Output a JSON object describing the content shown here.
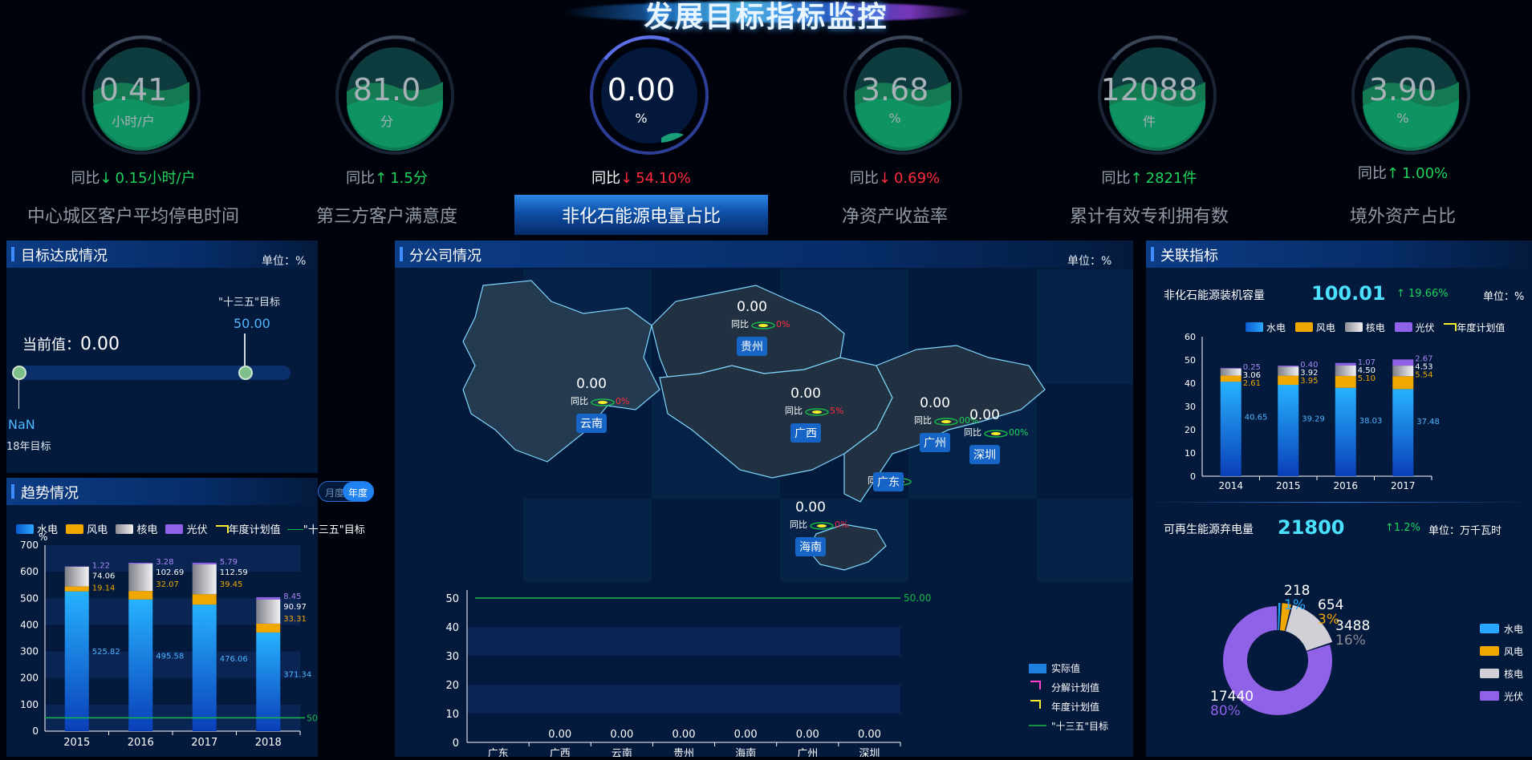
{
  "header": {
    "title": "发展目标指标监控"
  },
  "colors": {
    "hydro": "#1f7fe0",
    "wind": "#f0a800",
    "nuclear": "#c8c8cc",
    "solar": "#8f62e8",
    "up": "#1bd35d",
    "down": "#ff2a3d",
    "plan_line": "#f6f02c",
    "target_line": "#18b848"
  },
  "kpis": [
    {
      "value": "0.41",
      "unit": "小时/户",
      "compare_label": "同比",
      "arrow": "↓",
      "compare_value": "0.15小时/户",
      "trend": "up",
      "label": "中心城区客户平均停电时间"
    },
    {
      "value": "81.0",
      "unit": "分",
      "compare_label": "同比",
      "arrow": "↑",
      "compare_value": "1.5分",
      "trend": "up",
      "label": "第三方客户满意度"
    },
    {
      "value": "0.00",
      "unit": "%",
      "compare_label": "同比",
      "arrow": "↓",
      "compare_value": "54.10%",
      "trend": "down",
      "label": "非化石能源电量占比"
    },
    {
      "value": "3.68",
      "unit": "%",
      "compare_label": "同比",
      "arrow": "↓",
      "compare_value": "0.69%",
      "trend": "down",
      "label": "净资产收益率"
    },
    {
      "value": "12088",
      "unit": "件",
      "compare_label": "同比",
      "arrow": "↑",
      "compare_value": "2821件",
      "trend": "up",
      "label": "累计有效专利拥有数"
    },
    {
      "value": "3.90",
      "unit": "%",
      "compare_label": "同比",
      "arrow": "↑",
      "compare_value": "1.00%",
      "trend": "up",
      "label": "境外资产占比"
    }
  ],
  "target_panel": {
    "title": "目标达成情况",
    "unit": "单位：%",
    "current_label": "当前值：",
    "current_value": "0.00",
    "goal_label": "\"十三五\"目标",
    "goal_value": "50.00",
    "year_value": "NaN",
    "year_label": "18年目标"
  },
  "trend_panel": {
    "title": "趋势情况",
    "toggle": {
      "monthly": "月度",
      "yearly": "年度"
    },
    "legend": [
      "水电",
      "风电",
      "核电",
      "光伏",
      "年度计划值",
      "\"十三五\"目标"
    ],
    "y_unit": "%",
    "target_label": "50"
  },
  "branch_panel": {
    "title": "分公司情况",
    "unit": "单位：%",
    "regions": [
      {
        "name": "云南",
        "value": "0.00",
        "compare": "同比",
        "pct": "0%"
      },
      {
        "name": "贵州",
        "value": "0.00",
        "compare": "同比",
        "pct": "0%"
      },
      {
        "name": "广西",
        "value": "0.00",
        "compare": "同比",
        "pct": "5%"
      },
      {
        "name": "广州",
        "value": "0.00",
        "compare": "同比",
        "pct": "00%"
      },
      {
        "name": "深圳",
        "value": "0.00",
        "compare": "同比",
        "pct": "00%"
      },
      {
        "name": "广东",
        "value": "",
        "compare": "同比",
        "pct": ""
      },
      {
        "name": "海南",
        "value": "0.00",
        "compare": "同比",
        "pct": "0%"
      }
    ],
    "legend": [
      "实际值",
      "分解计划值",
      "年度计划值",
      "\"十三五\"目标"
    ],
    "target_label": "50.00"
  },
  "related_panel": {
    "title": "关联指标",
    "capacity_label": "非化石能源装机容量",
    "capacity_value": "100.01",
    "capacity_change": "↑ 19.66%",
    "capacity_unit": "单位：%",
    "legend": [
      "水电",
      "风电",
      "核电",
      "光伏",
      "年度计划值"
    ],
    "curtail_label": "可再生能源弃电量",
    "curtail_value": "21800",
    "curtail_change": "↑1.2%",
    "curtail_unit": "单位：万千瓦时",
    "donut_legend": [
      "水电",
      "风电",
      "核电",
      "光伏"
    ]
  },
  "chart_data": [
    {
      "type": "bar",
      "title": "趋势情况",
      "categories": [
        "2015",
        "2016",
        "2017",
        "2018"
      ],
      "ylim": [
        0,
        700
      ],
      "yticks": [
        0,
        100,
        200,
        300,
        400,
        500,
        600,
        700
      ],
      "series": [
        {
          "name": "水电",
          "values": [
            525.82,
            495.58,
            476.06,
            371.34
          ]
        },
        {
          "name": "风电",
          "values": [
            19.14,
            32.07,
            39.45,
            33.31
          ]
        },
        {
          "name": "核电",
          "values": [
            74.06,
            102.69,
            112.59,
            90.97
          ]
        },
        {
          "name": "光伏",
          "values": [
            1.22,
            3.28,
            5.79,
            8.45
          ]
        }
      ],
      "target": 50,
      "stacked": true
    },
    {
      "type": "bar",
      "title": "分公司情况",
      "categories": [
        "广东",
        "广西",
        "云南",
        "贵州",
        "海南",
        "广州",
        "深圳"
      ],
      "ylim": [
        0,
        50
      ],
      "yticks": [
        0,
        10,
        20,
        30,
        40,
        50
      ],
      "series": [
        {
          "name": "实际值",
          "values": [
            null,
            0.0,
            0.0,
            0.0,
            0.0,
            0.0,
            0.0
          ]
        }
      ],
      "value_labels": [
        "",
        "0.00",
        "0.00",
        "0.00",
        "0.00",
        "0.00",
        "0.00"
      ],
      "target": 50.0
    },
    {
      "type": "bar",
      "title": "非化石能源装机容量",
      "categories": [
        "2014",
        "2015",
        "2016",
        "2017"
      ],
      "ylim": [
        0,
        60
      ],
      "yticks": [
        0,
        10,
        20,
        30,
        40,
        50,
        60
      ],
      "series": [
        {
          "name": "水电",
          "values": [
            40.65,
            39.29,
            38.03,
            37.48
          ]
        },
        {
          "name": "风电",
          "values": [
            2.61,
            3.95,
            5.1,
            5.54
          ]
        },
        {
          "name": "核电",
          "values": [
            3.06,
            3.92,
            4.5,
            4.53
          ]
        },
        {
          "name": "光伏",
          "values": [
            0.25,
            0.4,
            1.07,
            2.67
          ]
        }
      ],
      "stacked": true
    },
    {
      "type": "pie",
      "title": "可再生能源弃电量",
      "labels": [
        "水电",
        "风电",
        "核电",
        "光伏"
      ],
      "values": [
        218,
        654,
        3488,
        17440
      ],
      "percent_labels": [
        "1%",
        "3%",
        "16%",
        "80%"
      ]
    }
  ]
}
